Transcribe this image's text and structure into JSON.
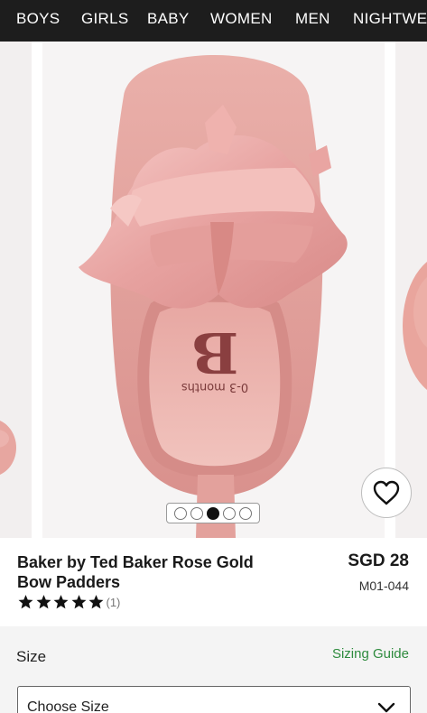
{
  "nav": {
    "items": [
      "BOYS",
      "GIRLS",
      "BABY",
      "WOMEN",
      "MEN",
      "NIGHTWE"
    ]
  },
  "gallery": {
    "image_count": 5,
    "active_index": 2,
    "insole_brand_text": "B",
    "insole_size_text": "0-3 months"
  },
  "product": {
    "title_line1": "Baker by Ted Baker Rose Gold",
    "title_line2": "Bow Padders",
    "rating": 5,
    "review_count": "(1)",
    "price": "SGD 28",
    "sku": "M01-044"
  },
  "size": {
    "label": "Size",
    "guide_link": "Sizing Guide",
    "placeholder": "Choose Size"
  },
  "colors": {
    "nav_bg": "#1d1d1d",
    "shoe_pink": "#e9a7a6",
    "sizing_green": "#2e8b3e"
  },
  "icons": {
    "favourite": "heart-outline-icon",
    "rating": "star-icon",
    "dropdown": "chevron-down-icon"
  }
}
